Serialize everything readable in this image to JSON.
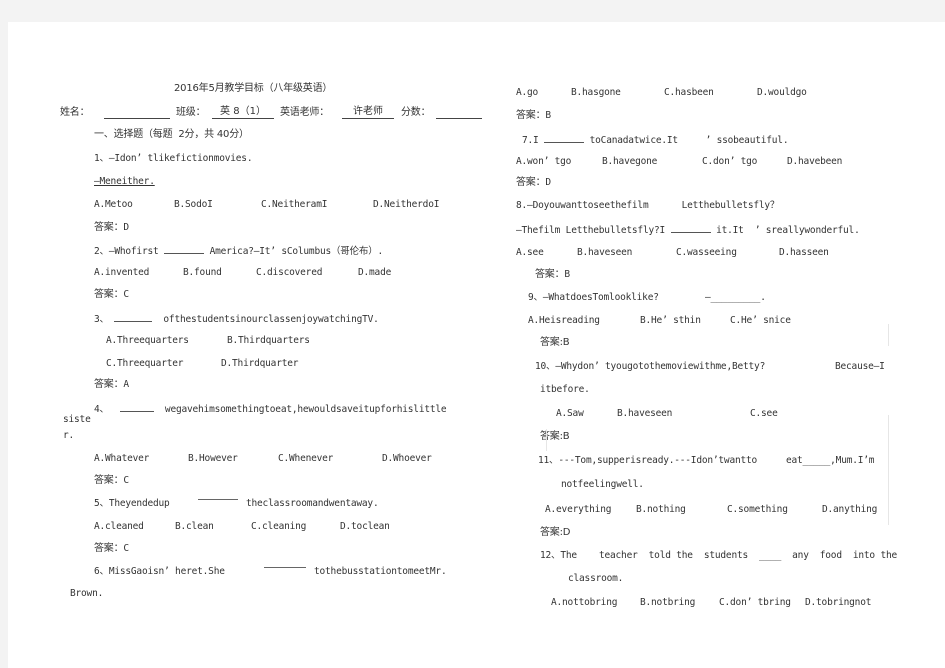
{
  "header": {
    "title": "2016年5月教学目标（八年级英语）",
    "name_label": "姓名：",
    "name_value": "",
    "class_label": "班级：",
    "class_value": "英 8（1）",
    "teacher_label": "英语老师：",
    "teacher_value": "许老师",
    "score_label": "分数：",
    "score_value": ""
  },
  "section": {
    "heading": "一、选择题（每题  2分，共 40分）"
  },
  "answer_prefix": "答案：",
  "questions": [
    {
      "number": "1、",
      "stem_lines": [
        "—Idon’ tlikefictionmovies.",
        "—Meneither."
      ],
      "options": [
        "A.Metoo",
        "B.SodoI",
        "C.NeitheramI",
        "D.NeitherdoI"
      ],
      "answer": "D"
    },
    {
      "number": "2、",
      "stem_before": "—Whofirst",
      "stem_after": "America?—It’ sColumbus（哥伦布）.",
      "options": [
        "A.invented",
        "B.found",
        "C.discovered",
        "D.made"
      ],
      "answer": "C"
    },
    {
      "number": "3、",
      "stem_after": "ofthestudentsinourclassenjoywatchingTV.",
      "options": [
        "A.Threequarters",
        "B.Thirdquarters",
        "C.Threequarter",
        "D.Thirdquarter"
      ],
      "answer": "A"
    },
    {
      "number": "4、",
      "stem_after": "wegavehimsomethingtoeat,hewouldsaveitupforhislittle",
      "stem_wrap": [
        "siste",
        "r."
      ],
      "options": [
        "A.Whatever",
        "B.However",
        "C.Whenever",
        "D.Whoever"
      ],
      "answer": "C"
    },
    {
      "number": "5、",
      "stem_before": "Theyendedup",
      "stem_after": "theclassroomandwentaway.",
      "options": [
        "A.cleaned",
        "B.clean",
        "C.cleaning",
        "D.toclean"
      ],
      "answer": "C"
    },
    {
      "number": "6、",
      "stem_before": "MissGaoisn’ heret.She",
      "stem_after": "tothebusstationtomeetMr.",
      "stem_wrap": [
        "Brown."
      ],
      "options": [
        "A.go",
        "B.hasgone",
        "C.hasbeen",
        "D.wouldgo"
      ],
      "answer": "B"
    },
    {
      "number": "7.",
      "stem_before": "I",
      "stem_after": "toCanadatwice.It     ’ ssobeautiful.",
      "options": [
        "A.won’ tgo",
        "B.havegone",
        "C.don’ tgo",
        "D.havebeen"
      ],
      "answer": "D"
    },
    {
      "number": "8.",
      "stem_line1": "—Doyouwanttoseethefilm      Letthebulletsfly？",
      "stem_before": "—Thefilm Letthebulletsfly?I",
      "stem_after": "it.It  ’ sreallywonderful.",
      "options": [
        "A.see",
        "B.haveseen",
        "C.wasseeing",
        "D.hasseen"
      ],
      "answer": "B"
    },
    {
      "number": "9、",
      "stem_before": "—WhatdoesTomlooklike?",
      "stem_after": "—_________.",
      "options": [
        "A.Heisreading",
        "B.He’ sthin",
        "C.He’ snice"
      ],
      "answer": "B"
    },
    {
      "number": "10、",
      "stem_before": "—Whydon’ tyougotothemoviewithme,Betty?",
      "stem_after": "Because—I",
      "stem_wrap": [
        "itbefore."
      ],
      "options": [
        "A.Saw",
        "B.haveseen",
        "C.see"
      ],
      "answer": "B"
    },
    {
      "number": "11、",
      "stem_before": "---Tom,supperisready.---Idon’twantto",
      "stem_after": "eat_____,Mum.I’m",
      "stem_wrap": [
        "notfeelingwell."
      ],
      "options": [
        "A.everything",
        "B.nothing",
        "C.something",
        "D.anything"
      ],
      "answer": "D"
    },
    {
      "number": "12、",
      "stem_before": "The    teacher  told the  students  ____  any  food  into the",
      "stem_wrap": [
        "classroom."
      ],
      "options": [
        "A.nottobring",
        "B.notbring",
        "C.don’ tbring",
        "D.tobringnot"
      ]
    }
  ],
  "answers_display": {
    "q9": "答案:B",
    "q10": "答案:B",
    "q11": "答案:D"
  }
}
